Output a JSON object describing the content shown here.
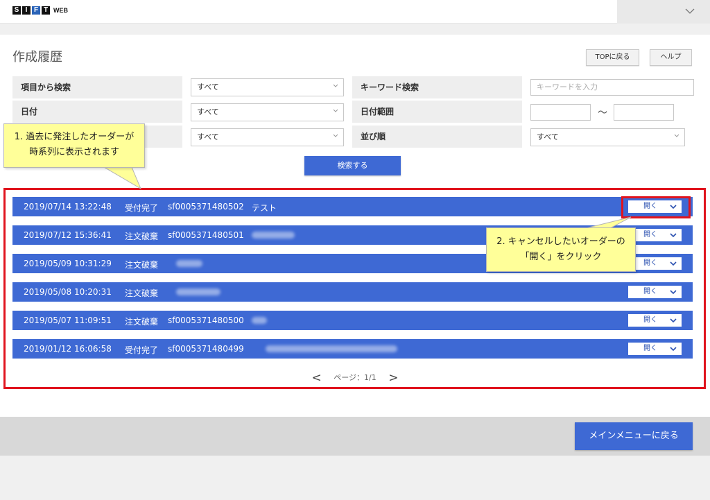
{
  "header": {
    "logo_letters": [
      "S",
      "I",
      "F",
      "T"
    ],
    "logo_suffix": "WEB"
  },
  "page": {
    "title": "作成履歴",
    "top_button": "TOPに戻る",
    "help_button": "ヘルプ"
  },
  "search": {
    "item_label": "項目から検索",
    "item_value": "すべて",
    "keyword_label": "キーワード検索",
    "keyword_placeholder": "キーワードを入力",
    "date_label": "日付",
    "date_value": "すべて",
    "range_label": "日付範囲",
    "range_sep": "～",
    "third_value": "すべて",
    "sort_label": "並び順",
    "sort_value": "すべて",
    "submit": "検索する"
  },
  "callouts": {
    "c1_line1": "1. 過去に発注したオーダーが",
    "c1_line2": "時系列に表示されます",
    "c2_line1": "2. キャンセルしたいオーダーの",
    "c2_line2": "「開く」をクリック"
  },
  "orders": [
    {
      "date": "2019/07/14 13:22:48",
      "status": "受付完了",
      "order_no": "sf0005371480502",
      "memo": "テスト"
    },
    {
      "date": "2019/07/12 15:36:41",
      "status": "注文破棄",
      "order_no": "sf0005371480501",
      "memo": ""
    },
    {
      "date": "2019/05/09 10:31:29",
      "status": "注文破棄",
      "order_no": "",
      "memo": ""
    },
    {
      "date": "2019/05/08 10:20:31",
      "status": "注文破棄",
      "order_no": "",
      "memo": ""
    },
    {
      "date": "2019/05/07 11:09:51",
      "status": "注文破棄",
      "order_no": "sf0005371480500",
      "memo": ""
    },
    {
      "date": "2019/01/12 16:06:58",
      "status": "受付完了",
      "order_no": "sf0005371480499",
      "memo": ""
    }
  ],
  "open_label": "開く",
  "pager": {
    "prev": "<",
    "text": "ページ：1/1",
    "next": ">"
  },
  "footer": {
    "main_menu": "メインメニューに戻る"
  },
  "colors": {
    "accent": "#3e69d4",
    "highlight": "#e0141e",
    "callout": "#ffff99"
  }
}
